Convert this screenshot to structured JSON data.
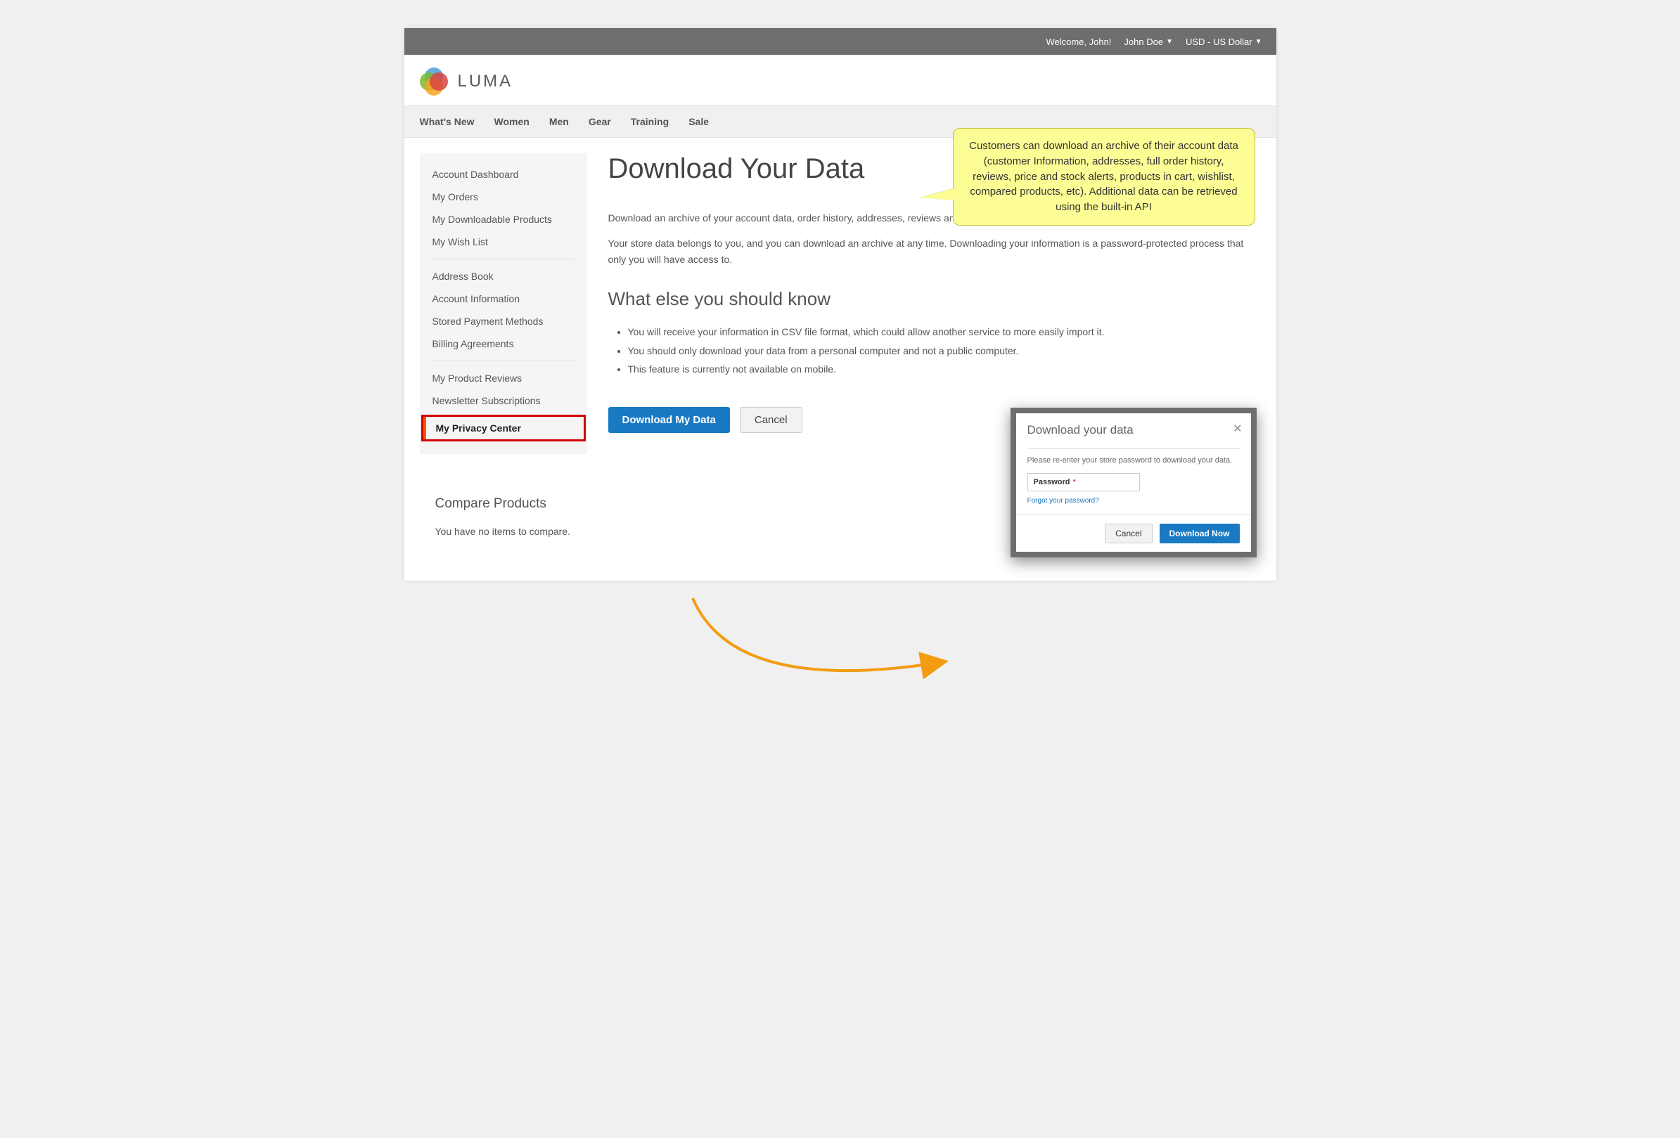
{
  "topbar": {
    "welcome": "Welcome, John!",
    "user": "John Doe",
    "currency": "USD - US Dollar"
  },
  "brand": "LUMA",
  "nav": [
    "What's New",
    "Women",
    "Men",
    "Gear",
    "Training",
    "Sale"
  ],
  "sidebar": {
    "group1": [
      "Account Dashboard",
      "My Orders",
      "My Downloadable Products",
      "My Wish List"
    ],
    "group2": [
      "Address Book",
      "Account Information",
      "Stored Payment Methods",
      "Billing Agreements"
    ],
    "group3": [
      "My Product Reviews",
      "Newsletter Subscriptions"
    ],
    "active": "My Privacy Center"
  },
  "compare": {
    "heading": "Compare Products",
    "empty": "You have no items to compare."
  },
  "main": {
    "title": "Download Your Data",
    "intro1": "Download an archive of your account data, order history, addresses, reviews and more.",
    "intro2": "Your store data belongs to you, and you can download an archive at any time. Downloading your information is a password-protected process that only you will have access to.",
    "know_heading": "What else you should know",
    "know": [
      "You will receive your information in CSV file format, which could allow another service to more easily import it.",
      "You should only download your data from a personal computer and not a public computer.",
      "This feature is currently not available on mobile."
    ],
    "download_btn": "Download My Data",
    "cancel_btn": "Cancel"
  },
  "callout": "Customers can download an archive of their account data (customer Information, addresses, full order history, reviews, price and stock alerts, products in cart, wishlist, compared products, etc). Additional data can be retrieved using the built-in API",
  "modal": {
    "title": "Download your data",
    "hint": "Please re-enter your store password to download your data.",
    "pw_label": "Password",
    "forgot": "Forgot your password?",
    "cancel": "Cancel",
    "download": "Download Now"
  }
}
